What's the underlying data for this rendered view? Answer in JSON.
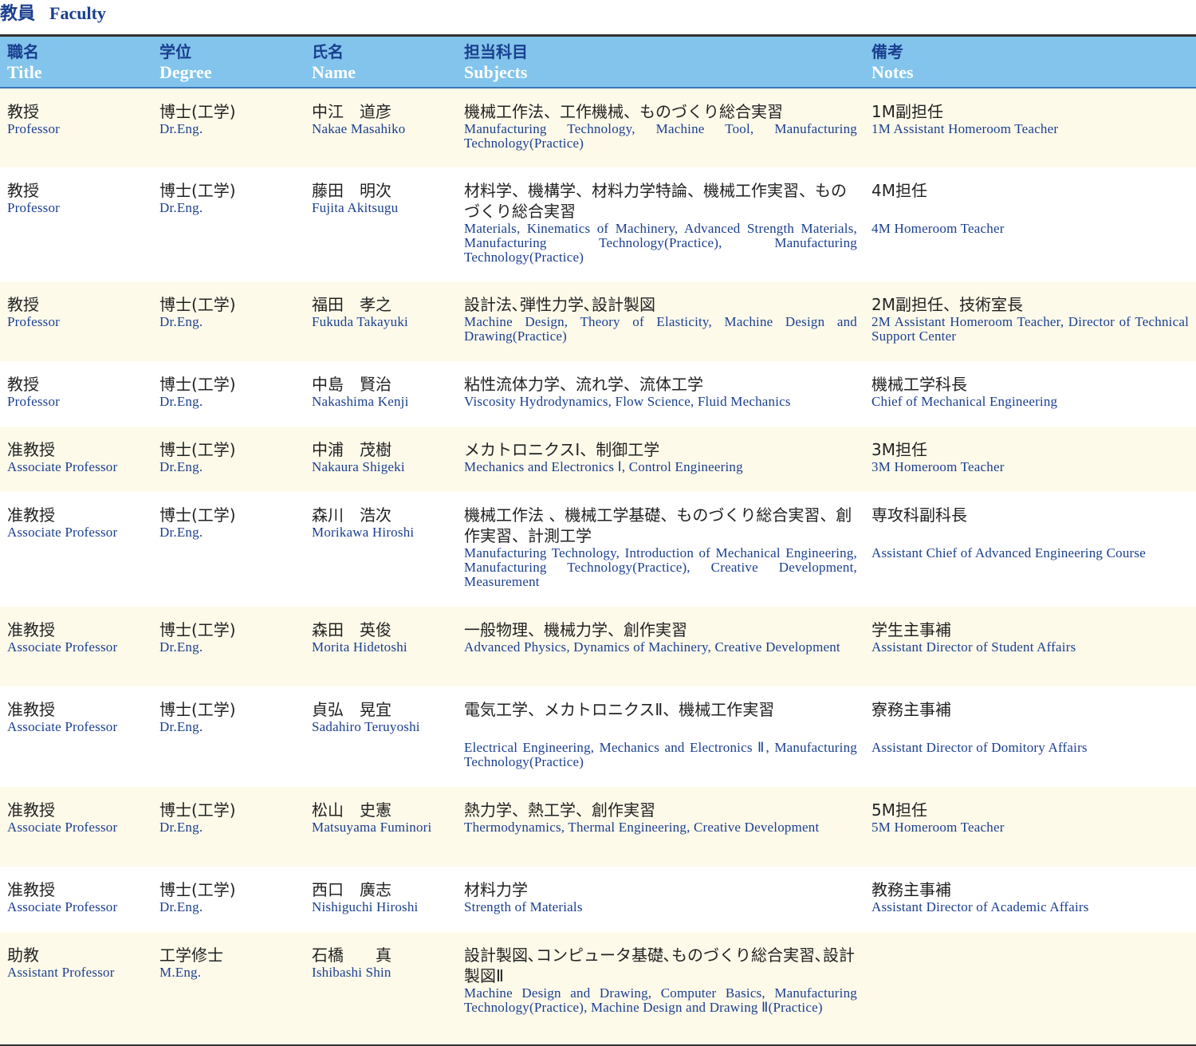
{
  "heading": {
    "jp": "教員",
    "en": "Faculty"
  },
  "columns": [
    {
      "jp": "職名",
      "en": "Title"
    },
    {
      "jp": "学位",
      "en": "Degree"
    },
    {
      "jp": "氏名",
      "en": "Name"
    },
    {
      "jp": "担当科目",
      "en": "Subjects"
    },
    {
      "jp": "備考",
      "en": "Notes"
    }
  ],
  "rows": [
    {
      "title_jp": "教授",
      "title_en": "Professor",
      "degree_jp": "博士(工学)",
      "degree_en": "Dr.Eng.",
      "name_jp": "中江　道彦",
      "name_en": "Nakae Masahiko",
      "subjects_jp": "機械工作法、工作機械、ものづくり総合実習",
      "subjects_en": "Manufacturing Technology, Machine Tool, Manufacturing Technology(Practice)",
      "notes_jp": "1M副担任",
      "notes_en": "1M Assistant Homeroom Teacher"
    },
    {
      "title_jp": "教授",
      "title_en": "Professor",
      "degree_jp": "博士(工学)",
      "degree_en": "Dr.Eng.",
      "name_jp": "藤田　明次",
      "name_en": "Fujita Akitsugu",
      "subjects_jp": "材料学、機構学、材料力学特論、機械工作実習、ものづくり総合実習",
      "subjects_en": "Materials, Kinematics of Machinery, Advanced Strength Materials, Manufacturing Technology(Practice), Manufacturing Technology(Practice)",
      "notes_jp": "4M担任",
      "notes_en": "4M Homeroom Teacher"
    },
    {
      "title_jp": "教授",
      "title_en": "Professor",
      "degree_jp": "博士(工学)",
      "degree_en": "Dr.Eng.",
      "name_jp": "福田　孝之",
      "name_en": "Fukuda Takayuki",
      "subjects_jp": "設計法､弾性力学､設計製図",
      "subjects_en": "Machine Design, Theory of Elasticity, Machine Design and Drawing(Practice)",
      "notes_jp": "2M副担任、技術室長",
      "notes_en": "2M Assistant Homeroom Teacher, Director of Technical Support Center"
    },
    {
      "title_jp": "教授",
      "title_en": "Professor",
      "degree_jp": "博士(工学)",
      "degree_en": "Dr.Eng.",
      "name_jp": "中島　賢治",
      "name_en": "Nakashima Kenji",
      "subjects_jp": "粘性流体力学、流れ学、流体工学",
      "subjects_en": "Viscosity Hydrodynamics, Flow Science, Fluid Mechanics",
      "notes_jp": "機械工学科長",
      "notes_en": "Chief of Mechanical Engineering"
    },
    {
      "title_jp": "准教授",
      "title_en": "Associate Professor",
      "degree_jp": "博士(工学)",
      "degree_en": "Dr.Eng.",
      "name_jp": "中浦　茂樹",
      "name_en": "Nakaura Shigeki",
      "subjects_jp": "メカトロニクスⅠ、制御工学",
      "subjects_en": "Mechanics and Electronics Ⅰ, Control Engineering",
      "notes_jp": "3M担任",
      "notes_en": "3M Homeroom Teacher"
    },
    {
      "title_jp": "准教授",
      "title_en": "Associate Professor",
      "degree_jp": "博士(工学)",
      "degree_en": "Dr.Eng.",
      "name_jp": "森川　浩次",
      "name_en": "Morikawa Hiroshi",
      "subjects_jp": "機械工作法 、機械工学基礎、ものづくり総合実習、創作実習、計測工学",
      "subjects_en": "Manufacturing Technology, Introduction of Mechanical Engineering, Manufacturing Technology(Practice), Creative Development, Measurement",
      "notes_jp": "専攻科副科長",
      "notes_en": "Assistant Chief of Advanced Engineering Course"
    },
    {
      "title_jp": "准教授",
      "title_en": "Associate Professor",
      "degree_jp": "博士(工学)",
      "degree_en": "Dr.Eng.",
      "name_jp": "森田　英俊",
      "name_en": "Morita Hidetoshi",
      "subjects_jp": "一般物理、機械力学、創作実習",
      "subjects_en": "Advanced Physics, Dynamics of Machinery, Creative Development",
      "notes_jp": "学生主事補",
      "notes_en": "Assistant Director of Student Affairs"
    },
    {
      "title_jp": "准教授",
      "title_en": "Associate Professor",
      "degree_jp": "博士(工学)",
      "degree_en": "Dr.Eng.",
      "name_jp": "貞弘　晃宜",
      "name_en": "Sadahiro Teruyoshi",
      "subjects_jp": "電気工学、メカトロニクスⅡ、機械工作実習",
      "subjects_en": "Electrical Engineering, Mechanics and Electronics Ⅱ, Manufacturing Technology(Practice)",
      "notes_jp": "寮務主事補",
      "notes_en": "Assistant Director of Domitory Affairs"
    },
    {
      "title_jp": "准教授",
      "title_en": "Associate Professor",
      "degree_jp": "博士(工学)",
      "degree_en": "Dr.Eng.",
      "name_jp": "松山　史憲",
      "name_en": "Matsuyama Fuminori",
      "subjects_jp": "熱力学、熱工学、創作実習",
      "subjects_en": "Thermodynamics, Thermal Engineering, Creative Development",
      "notes_jp": "5M担任",
      "notes_en": "5M Homeroom Teacher"
    },
    {
      "title_jp": "准教授",
      "title_en": "Associate Professor",
      "degree_jp": "博士(工学)",
      "degree_en": "Dr.Eng.",
      "name_jp": "西口　廣志",
      "name_en": "Nishiguchi Hiroshi",
      "subjects_jp": "材料力学",
      "subjects_en": "Strength of Materials",
      "notes_jp": "教務主事補",
      "notes_en": "Assistant Director of Academic Affairs"
    },
    {
      "title_jp": "助教",
      "title_en": "Assistant Professor",
      "degree_jp": "工学修士",
      "degree_en": "M.Eng.",
      "name_jp": "石橋　　真",
      "name_en": "Ishibashi Shin",
      "subjects_jp": "設計製図､コンピュータ基礎､ものづくり総合実習､設計製図Ⅱ",
      "subjects_en": "Machine Design and Drawing, Computer Basics, Manufacturing Technology(Practice), Machine Design and Drawing Ⅱ(Practice)",
      "notes_jp": "",
      "notes_en": ""
    }
  ]
}
